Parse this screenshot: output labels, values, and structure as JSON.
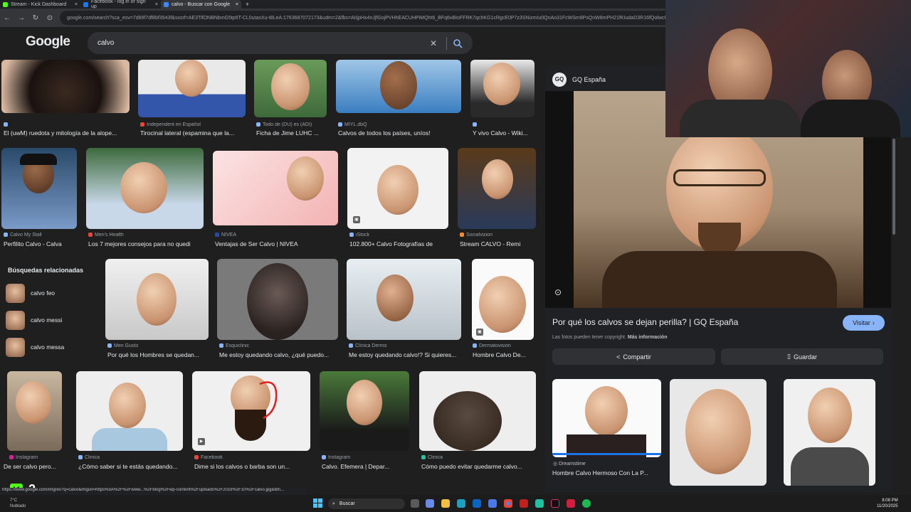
{
  "browser": {
    "tabs": [
      {
        "title": "Stream - Kick Dashboard",
        "color": "#53fc18"
      },
      {
        "title": "Facebook - log in or sign up",
        "color": "#1877f2"
      },
      {
        "title": "calvo - Buscar con Google",
        "color": "#4285f4"
      }
    ],
    "url": "google.com/search?sca_esv=7d89f7df8bf3943f&sxsrf=AE3TifONBNbmG5tp6T-CL0utasXu-t8LeA:1763687072173&udm=2&fbs=AIIjpHx4nJjfGojPVHhEACUHPiMQht6_BFq6vBIoFFRK7qchKG1cRgcE0P7z3SNizmIu0QnAo31FcWSm9PsQnW8mPH21fKIudaD3R16fQolwc62HTyRj27qB"
  },
  "google": {
    "logo": "Google",
    "query": "calvo"
  },
  "results_row1": [
    {
      "source": "",
      "title": "El (uwM) ruedota y mitología de la alope..."
    },
    {
      "source": "Independent en Español",
      "title": "Tirocinal lateral (espamina que la..."
    },
    {
      "source": "Todo de (DU) es (ADI)",
      "title": "Ficha de Jime LUHC ..."
    },
    {
      "source": "MIYL.dbQ",
      "title": "Calvos de todos los países, uníos!"
    },
    {
      "source": "",
      "title": "Y vivo Calvo - Wiki..."
    }
  ],
  "results_row2": [
    {
      "source": "Calvo My Stall",
      "title": "Perfilito Calvo - Calva"
    },
    {
      "source": "Men's Health",
      "title": "Los 7 mejores consejos para no quedi"
    },
    {
      "source": "NIVEA",
      "title": "Ventajas de Ser Calvo | NIVEA"
    },
    {
      "source": "iStock",
      "title": "102.800+ Calvo Fotografías de"
    },
    {
      "source": "Socialvizion",
      "title": "Stream CALVO - Remi"
    }
  ],
  "related": {
    "title": "Búsquedas relacionadas",
    "items": [
      "calvo feo",
      "calvo messi",
      "calvo messa"
    ]
  },
  "results_row3": [
    {
      "source": "Men Gusto",
      "title": "Por qué los Hombres se quedan..."
    },
    {
      "source": "Esquiclinic",
      "title": "Me estoy quedando calvo, ¿qué puedo..."
    },
    {
      "source": "Clínica Dermo",
      "title": "Me estoy quedando calvo!? Si quieres..."
    },
    {
      "source": "Dermatovisión",
      "title": "Hombre Calvo De..."
    }
  ],
  "results_row4": [
    {
      "source": "Instagram",
      "title": "De ser calvo pero..."
    },
    {
      "source": "Clinica",
      "title": "¿Cómo saber si te estás quedando..."
    },
    {
      "source": "Facebook",
      "title": "Dime si los calvos o barba son un..."
    },
    {
      "source": "Instagram",
      "title": "Calvo. Efemera | Depar..."
    },
    {
      "source": "Clinica",
      "title": "Cómo puedo evitar quedarme calvo..."
    }
  ],
  "panel": {
    "source": "GQ España",
    "source_logo": "GQ",
    "title": "Por qué los calvos se dejan perilla? | GQ España",
    "visit": "Visitar",
    "copyright": "Las fotos pueden tener copyright.",
    "more_info": "Más información",
    "share": "Compartir",
    "save": "Guardar",
    "related_source": "Dreamstime",
    "related_title": "Hombre Calvo Hermoso Con La P..."
  },
  "status_url": "https://www.google.com/imgres?q=calvo&imgurl=https%3A%2F%2Fwww...%2Fblog%2Fwp-content%2Fuploads%2F2019%2F10%2Fcalvo.jpg&tbn...",
  "overlay": {
    "kick_label": "K",
    "kick_count": "2"
  },
  "taskbar": {
    "weather_temp": "7°C",
    "weather_desc": "Nublado",
    "search": "Buscar",
    "time": "8:08 PM",
    "date": "11/20/2025"
  },
  "colors": {
    "accent": "#8ab4f8",
    "kick": "#53fc18",
    "background": "#1f1f1f"
  }
}
